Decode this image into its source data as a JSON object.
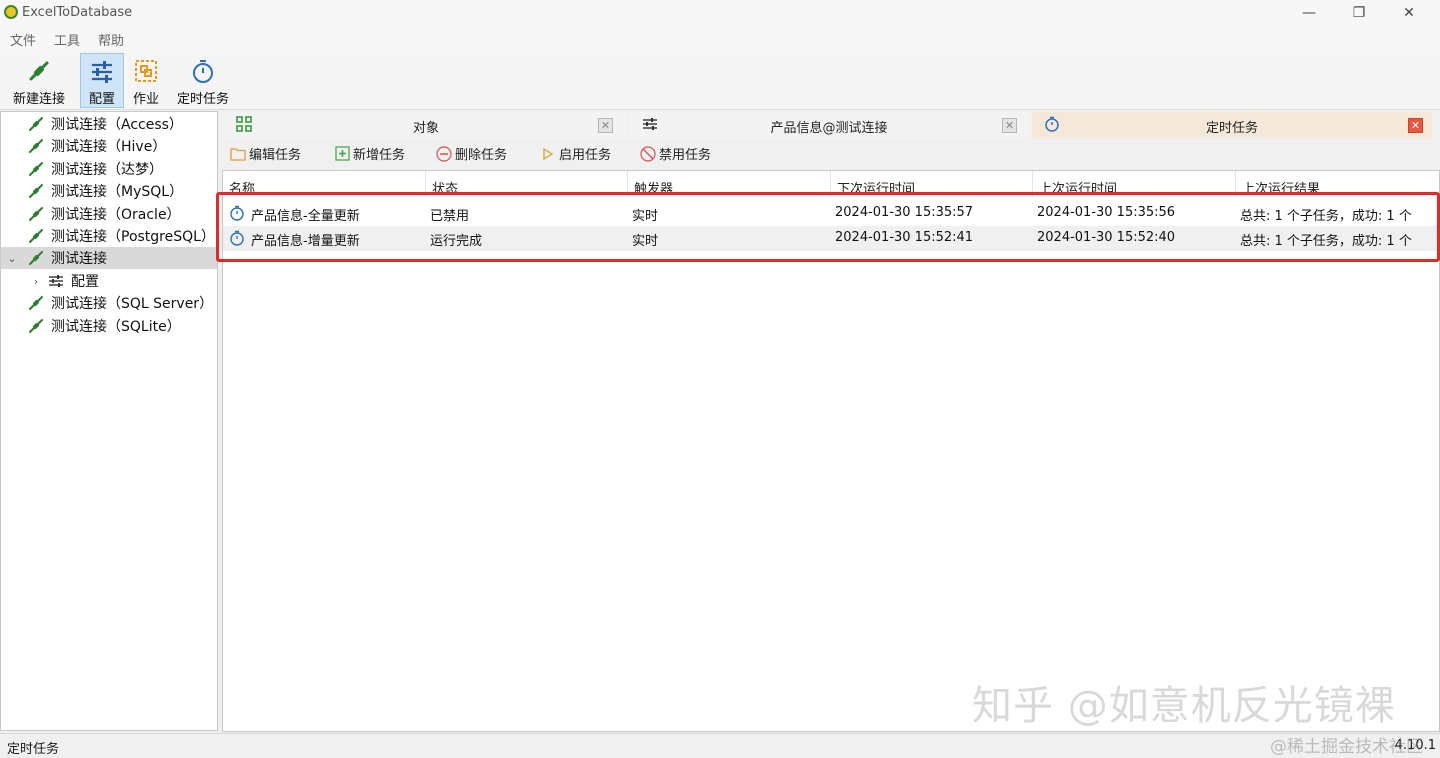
{
  "window": {
    "title": "ExcelToDatabase",
    "minimize": "—",
    "restore": "❐",
    "close": "✕"
  },
  "menu": [
    "文件",
    "工具",
    "帮助"
  ],
  "toolbar": {
    "new_connection": "新建连接",
    "config": "配置",
    "job": "作业",
    "schedule": "定时任务"
  },
  "tree": {
    "items": [
      "测试连接（Access）",
      "测试连接（Hive）",
      "测试连接（达梦）",
      "测试连接（MySQL）",
      "测试连接（Oracle）",
      "测试连接（PostgreSQL）",
      "测试连接",
      "配置",
      "测试连接（SQL Server）",
      "测试连接（SQLite）"
    ]
  },
  "tabs": [
    {
      "title": "对象",
      "close": "✕"
    },
    {
      "title": "产品信息@测试连接",
      "close": "✕"
    },
    {
      "title": "定时任务",
      "close": "✕"
    }
  ],
  "actions": {
    "edit": "编辑任务",
    "add": "新增任务",
    "delete": "删除任务",
    "enable": "启用任务",
    "disable": "禁用任务"
  },
  "grid": {
    "columns": [
      "名称",
      "状态",
      "触发器",
      "下次运行时间",
      "上次运行时间",
      "上次运行结果"
    ],
    "rows": [
      [
        "产品信息-全量更新",
        "已禁用",
        "实时",
        "2024-01-30 15:35:57",
        "2024-01-30 15:35:56",
        "总共: 1 个子任务，成功: 1 个"
      ],
      [
        "产品信息-增量更新",
        "运行完成",
        "实时",
        "2024-01-30 15:52:41",
        "2024-01-30 15:52:40",
        "总共: 1 个子任务，成功: 1 个"
      ]
    ]
  },
  "status": {
    "text": "定时任务",
    "version": "4.10.1"
  },
  "watermark": {
    "primary": "知乎 @如意机反光镜裸",
    "secondary": "@稀土掘金技术社区"
  },
  "colors": {
    "accent": "#2e7d32",
    "highlight": "#e02b2b",
    "active_tab": "#f6e8d8"
  }
}
